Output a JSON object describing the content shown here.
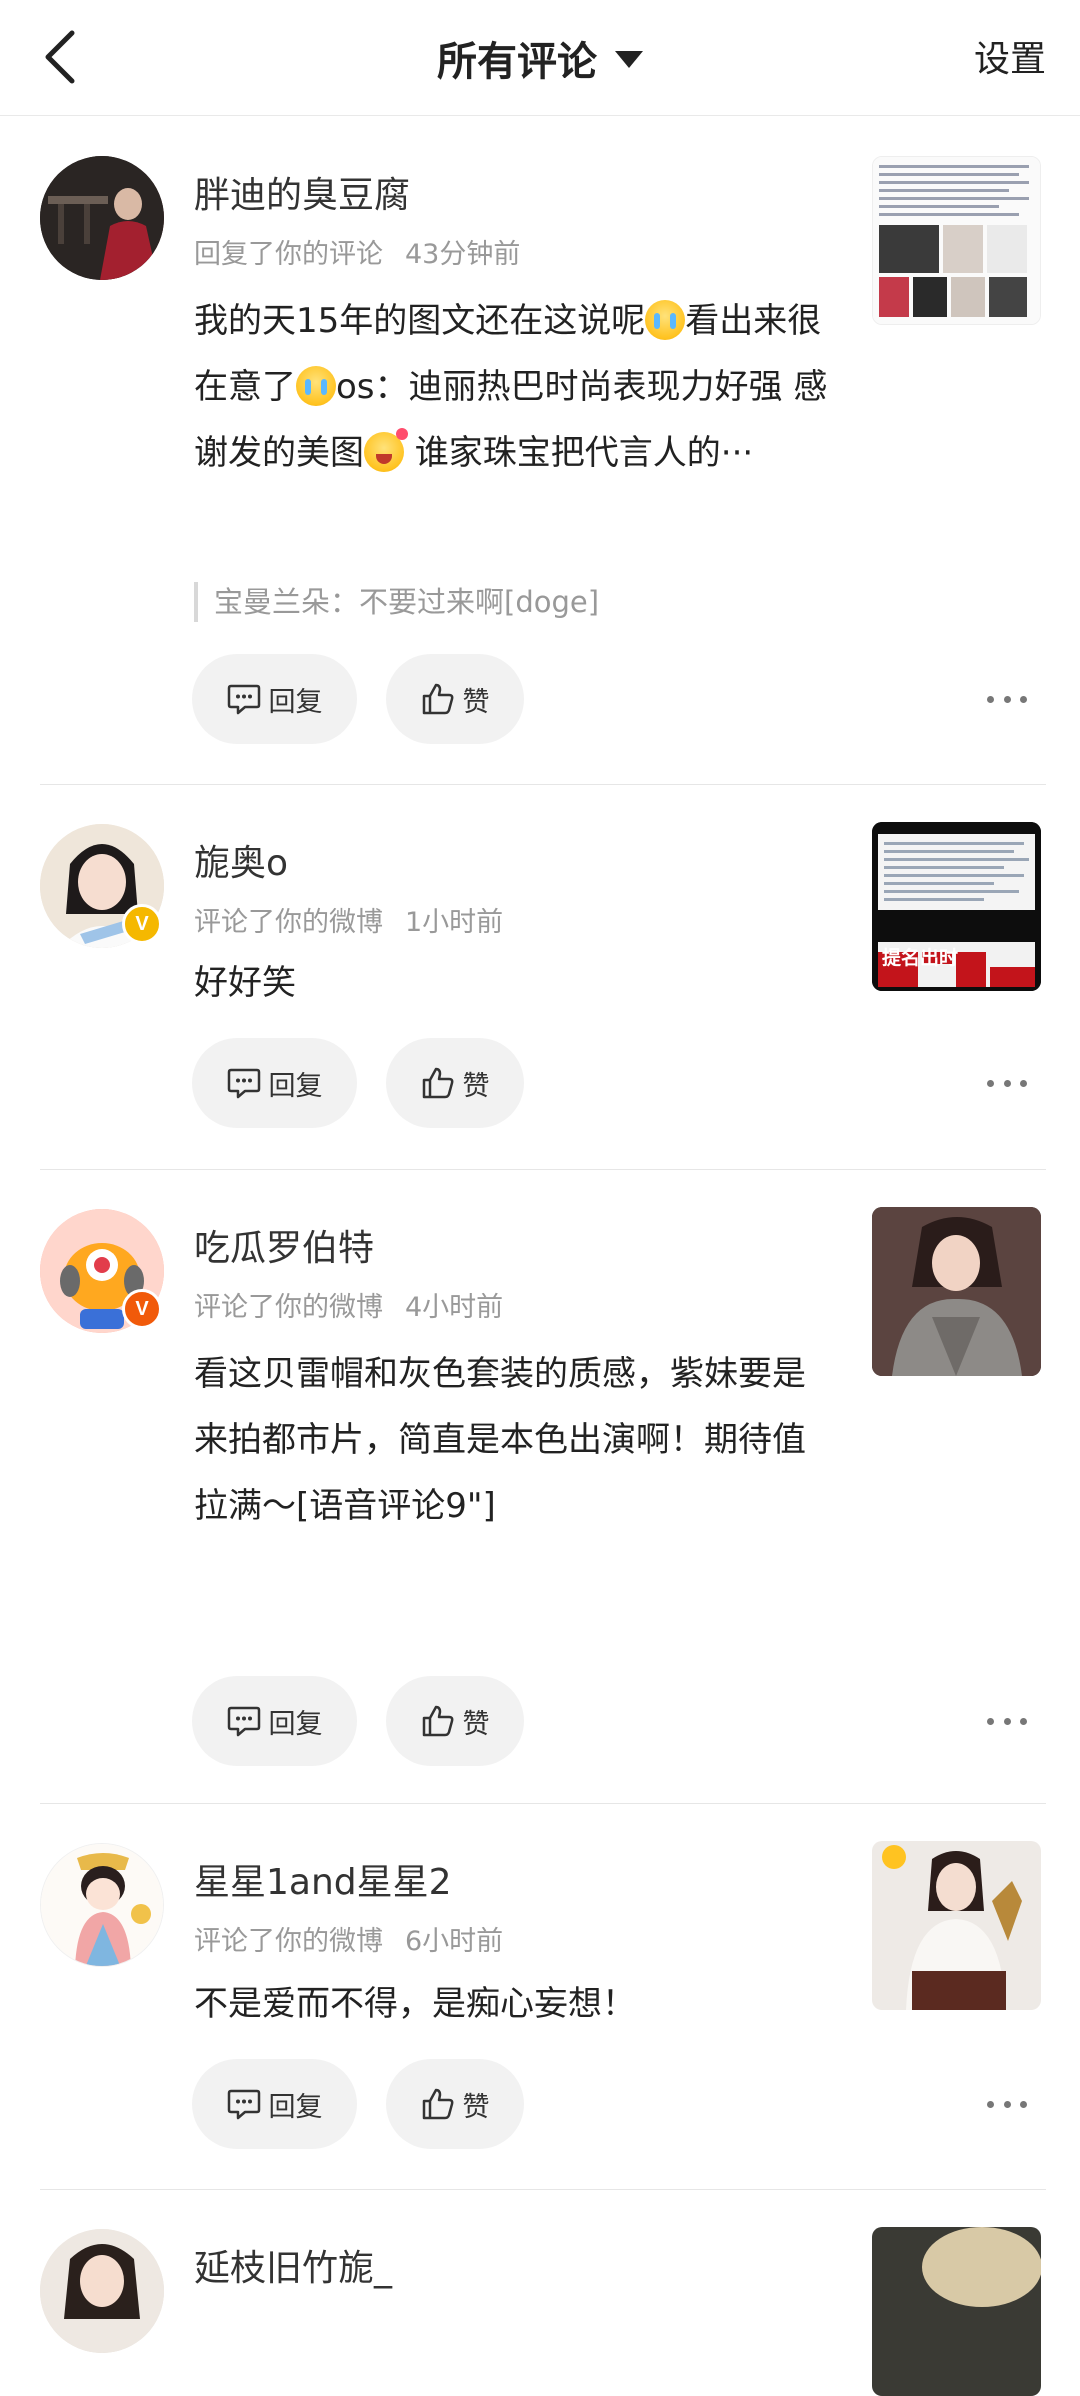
{
  "header": {
    "back_icon": "chevron-left-icon",
    "title": "所有评论",
    "dropdown_icon": "caret-down-icon",
    "settings_label": "设置"
  },
  "actions": {
    "reply_label": "回复",
    "like_label": "赞",
    "reply_icon": "comment-bubble-icon",
    "like_icon": "thumbs-up-icon",
    "more_icon": "more-dots-icon"
  },
  "comments": [
    {
      "username": "胖迪的臭豆腐",
      "action": "回复了你的评论",
      "time": "43分钟前",
      "content_parts": [
        "我的天15年的图文还在这说呢",
        "看出来很在意了",
        "os：迪丽热巴时尚表现力好强 感谢发的美图",
        " 谁家珠宝把代言人的···"
      ],
      "quote": "宝曼兰朵：不要过来啊[doge]",
      "verified": false
    },
    {
      "username": "旎奥o",
      "action": "评论了你的微博",
      "time": "1小时前",
      "content": "好好笑",
      "verified": true,
      "badge_color": "#f5b800",
      "thumb_text": "提名出时"
    },
    {
      "username": "吃瓜罗伯特",
      "action": "评论了你的微博",
      "time": "4小时前",
      "content": "看这贝雷帽和灰色套装的质感，紫妹要是来拍都市片，简直是本色出演啊！期待值拉满～[语音评论9\"]",
      "verified": true,
      "badge_color": "#f15a0a"
    },
    {
      "username": "星星1and星星2",
      "action": "评论了你的微博",
      "time": "6小时前",
      "content": "不是爱而不得，是痴心妄想！",
      "verified": false
    },
    {
      "username": "延枝旧竹旎_",
      "verified": false
    }
  ]
}
